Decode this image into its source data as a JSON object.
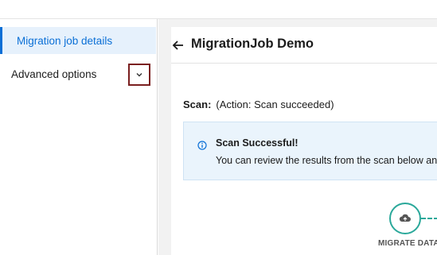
{
  "sidebar": {
    "items": [
      {
        "label": "Migration job details"
      },
      {
        "label": "Advanced options"
      }
    ]
  },
  "header": {
    "title": "MigrationJob Demo"
  },
  "scan": {
    "label": "Scan:",
    "status": "(Action: Scan succeeded)"
  },
  "alert": {
    "title": "Scan Successful!",
    "message": "You can review the results from the scan below and"
  },
  "steps": [
    {
      "label": "MIGRATE DATA",
      "icon": "cloud-upload-icon"
    }
  ],
  "colors": {
    "accent": "#0a6fd6",
    "active_bg": "#e6f1fc",
    "alert_bg": "#eaf4fc",
    "step": "#2aa89a",
    "highlight_box": "#7a1f1f"
  }
}
